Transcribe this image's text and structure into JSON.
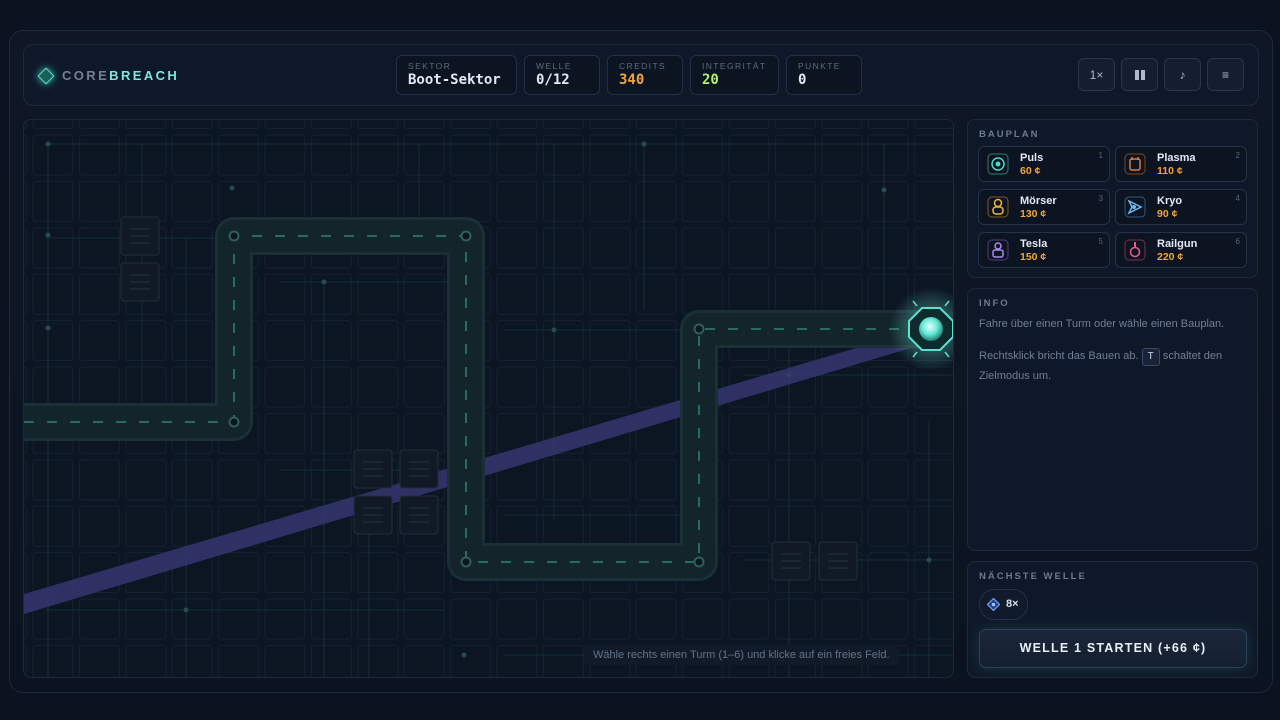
{
  "app": {
    "logo_a": "CORE",
    "logo_b": "BREACH"
  },
  "stats": [
    {
      "label": "SEKTOR",
      "value": "Boot-Sektor",
      "color": "#e2e9f3"
    },
    {
      "label": "WELLE",
      "value": "0/12",
      "color": "#e2e9f3"
    },
    {
      "label": "CREDITS",
      "value": "340",
      "color": "#f2a53a"
    },
    {
      "label": "INTEGRITÄT",
      "value": "20",
      "color": "#b6f06a"
    },
    {
      "label": "PUNKTE",
      "value": "0",
      "color": "#e2e9f3"
    }
  ],
  "controls": {
    "speed": "1×",
    "pause_icon": "pause-icon",
    "sound_icon": "music-note-icon",
    "menu_icon": "menu-icon"
  },
  "build": {
    "title": "BAUPLAN",
    "towers": [
      {
        "name": "Puls",
        "price": "60 ¢",
        "key": "1",
        "color": "#4fd6c4",
        "icon": "pulse-tower-icon"
      },
      {
        "name": "Plasma",
        "price": "110 ¢",
        "key": "2",
        "color": "#e07a3a",
        "icon": "plasma-tower-icon"
      },
      {
        "name": "Mörser",
        "price": "130 ¢",
        "key": "3",
        "color": "#f2b43a",
        "icon": "mortar-tower-icon"
      },
      {
        "name": "Kryo",
        "price": "90 ¢",
        "key": "4",
        "color": "#6ab8f2",
        "icon": "cryo-tower-icon"
      },
      {
        "name": "Tesla",
        "price": "150 ¢",
        "key": "5",
        "color": "#a98af2",
        "icon": "tesla-tower-icon"
      },
      {
        "name": "Railgun",
        "price": "220 ¢",
        "key": "6",
        "color": "#ec5a8c",
        "icon": "railgun-tower-icon"
      }
    ]
  },
  "info": {
    "title": "INFO",
    "line1": "Fahre über einen Turm oder wähle einen Bauplan.",
    "line2a": "Rechtsklick bricht das Bauen ab.",
    "key": "T",
    "line2b": "schaltet den Zielmodus um."
  },
  "next_wave": {
    "title": "NÄCHSTE WELLE",
    "count": "8×",
    "enemy_icon": "diamond-enemy-icon",
    "button": "WELLE 1 STARTEN (+66 ¢)"
  },
  "board": {
    "hint": "Wähle rechts einen Turm (1–6) und klicke auf ein freies Feld."
  },
  "colors": {
    "accent": "#5de0cf",
    "path": "#14252a",
    "beam": "#3b3a7a"
  }
}
